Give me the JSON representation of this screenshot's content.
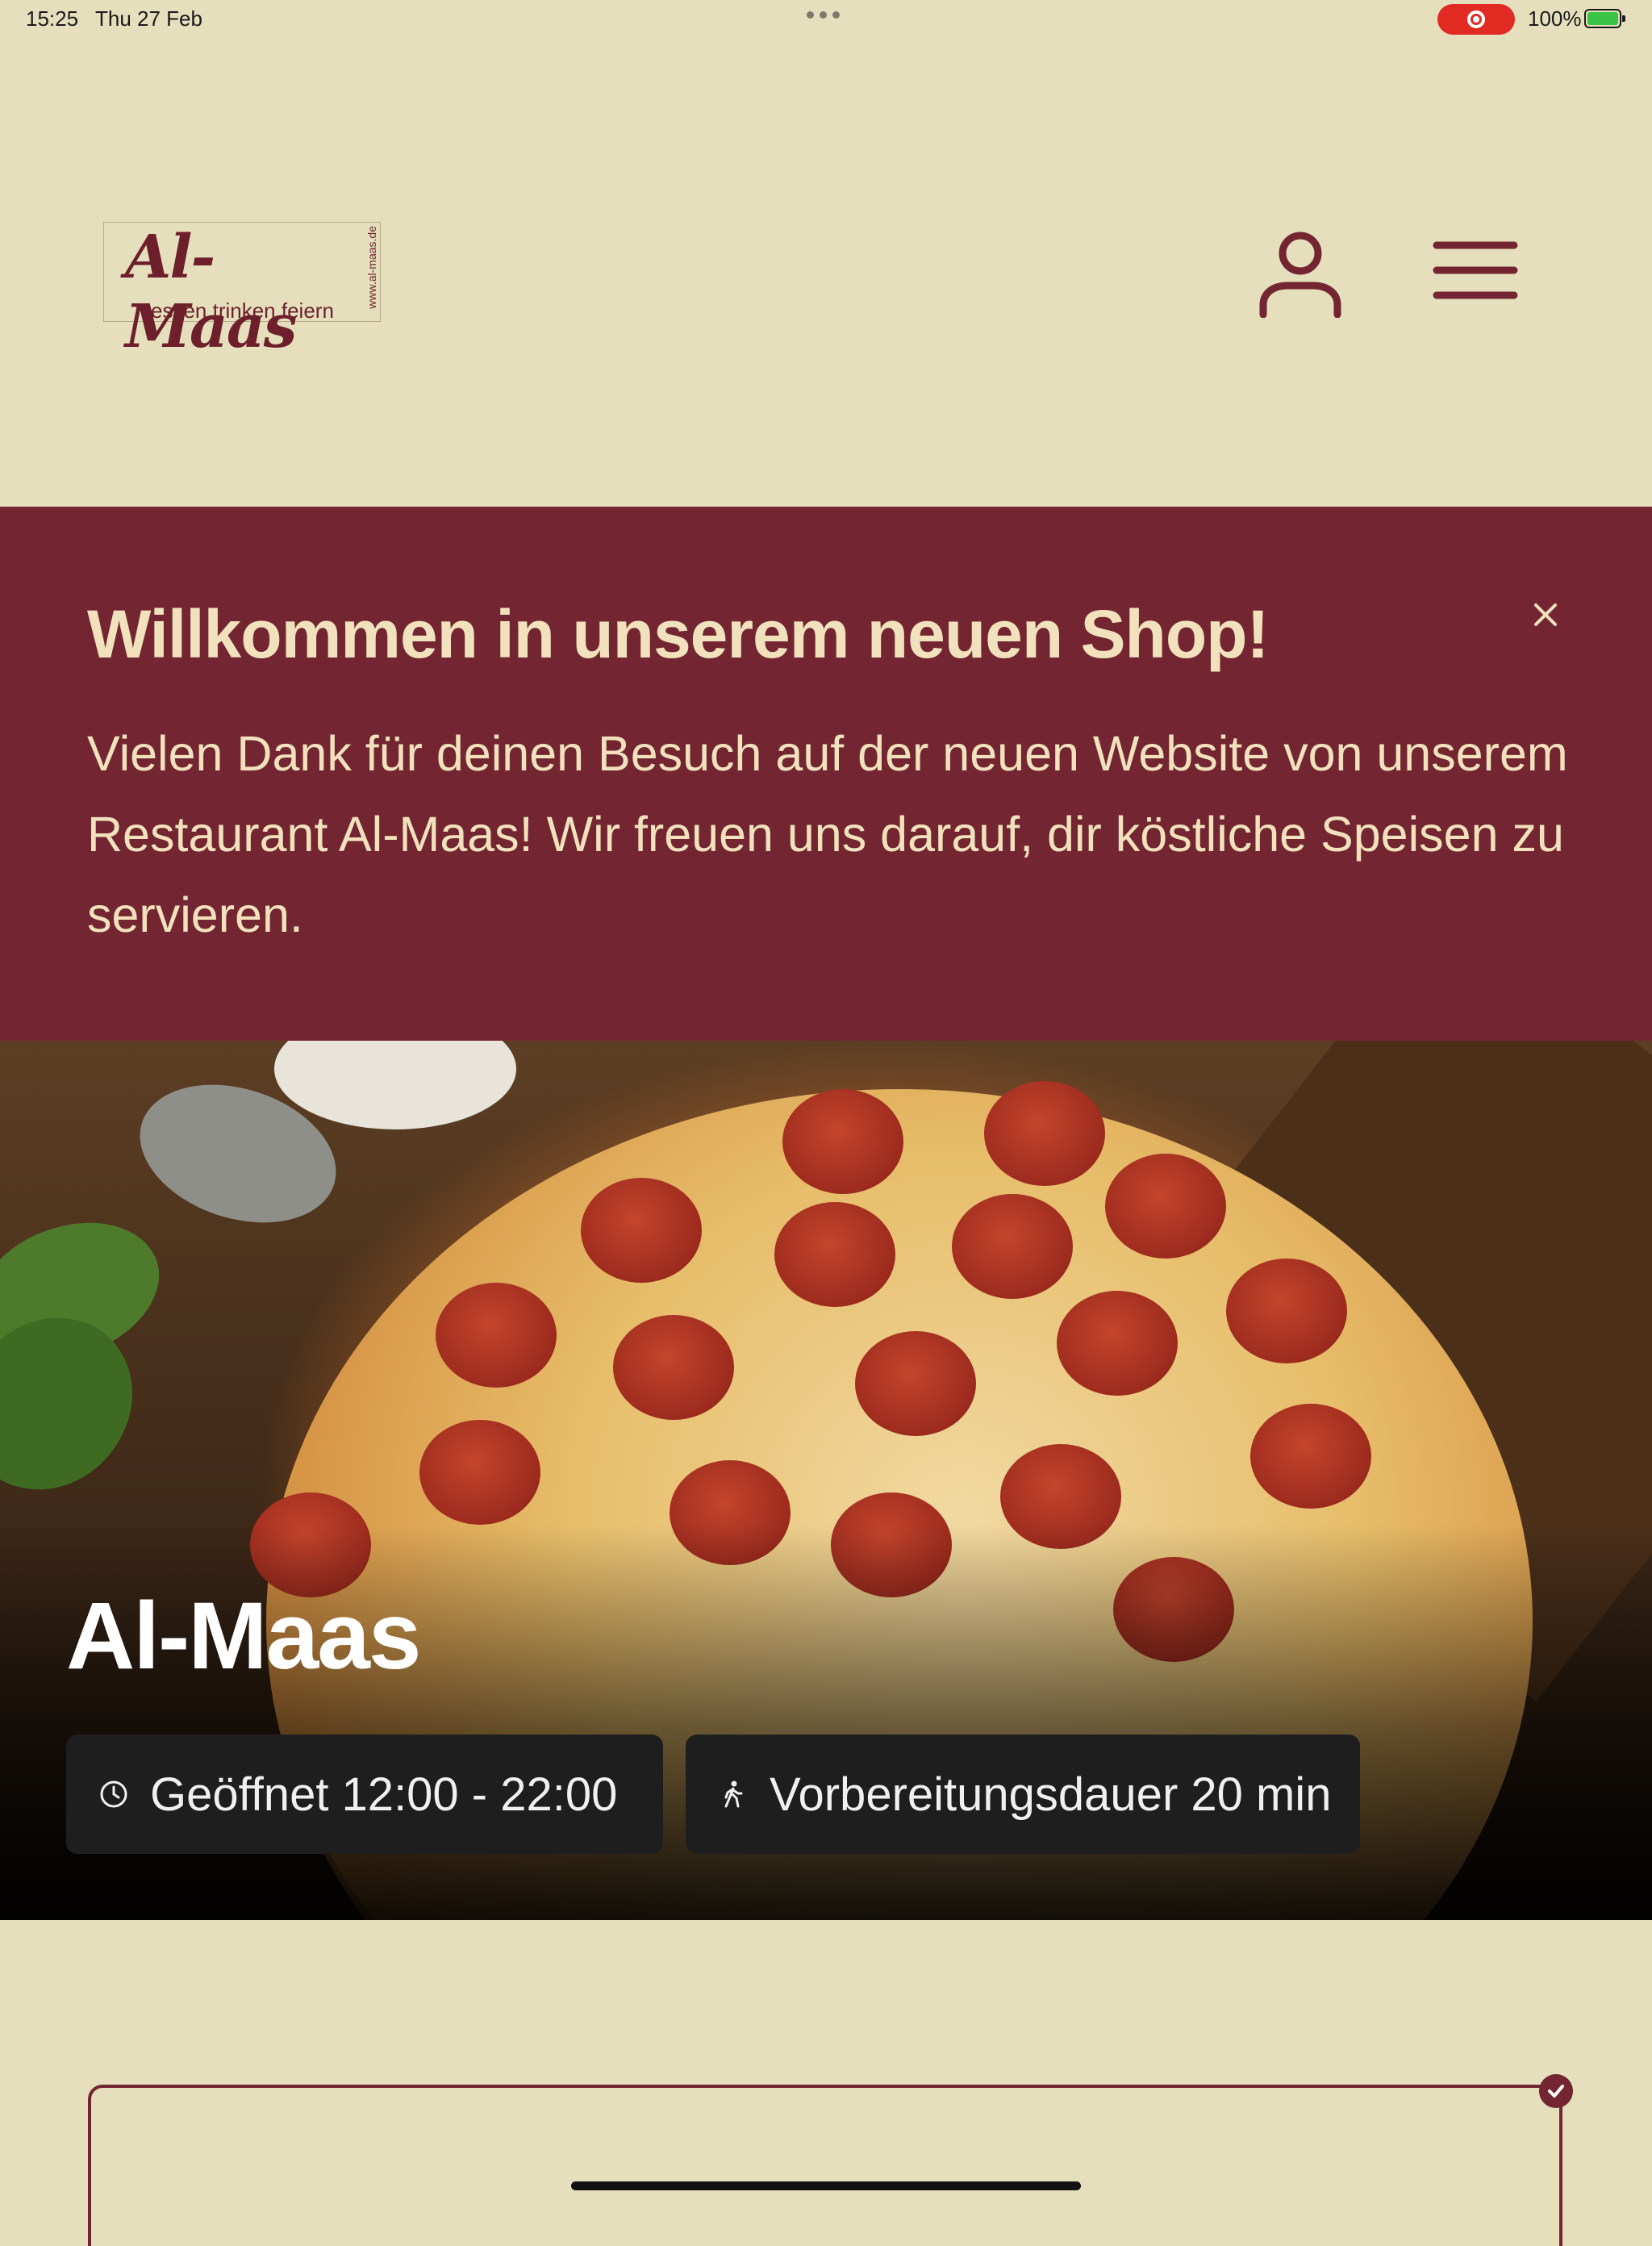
{
  "status_bar": {
    "time": "15:25",
    "date": "Thu 27 Feb",
    "battery": "100%"
  },
  "header": {
    "logo": {
      "name": "Al-Maas",
      "tagline": "essen trinken feiern",
      "url": "www.al-maas.de"
    }
  },
  "banner": {
    "title": "Willkommen in unserem neuen Shop!",
    "text": "Vielen Dank für deinen Besuch auf der neuen Website von unserem Restaurant Al-Maas! Wir freuen uns darauf, dir köstliche Speisen zu servieren."
  },
  "hero": {
    "title": "Al-Maas",
    "hours": "Geöffnet 12:00 - 22:00",
    "prep_time": "Vorbereitungsdauer 20 min"
  },
  "colors": {
    "background": "#e5dfbd",
    "primary": "#732531",
    "banner_text": "#f1e2bd",
    "chip_bg": "#1e1e1e"
  },
  "icons": {
    "user": "user-icon",
    "menu": "hamburger-menu-icon",
    "close": "close-icon",
    "clock": "clock-icon",
    "walk": "walking-icon",
    "check": "check-icon"
  }
}
